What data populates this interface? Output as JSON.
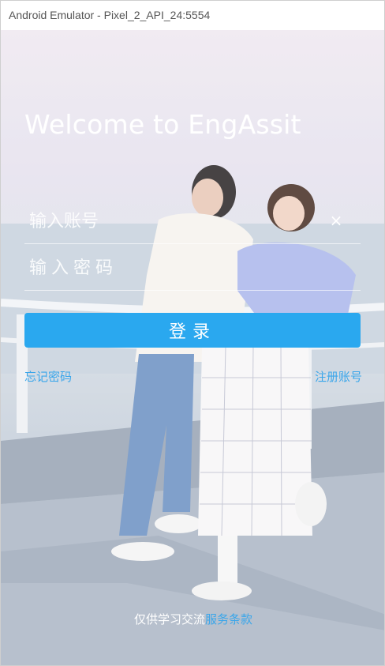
{
  "window": {
    "title": "Android Emulator - Pixel_2_API_24:5554"
  },
  "login": {
    "welcome_text": "Welcome to EngAssit",
    "account_placeholder": "输入账号",
    "password_placeholder": "输入密码",
    "clear_icon_text": "×",
    "login_button": "登录",
    "forgot_password": "忘记密码",
    "register": "注册账号",
    "footer_text": "仅供学习交流",
    "footer_terms": "服务条款"
  },
  "colors": {
    "accent": "#2aa8ef",
    "link": "#3aa6ea",
    "text_on_image": "#ffffff"
  },
  "icons": {
    "clear": "close-icon"
  }
}
